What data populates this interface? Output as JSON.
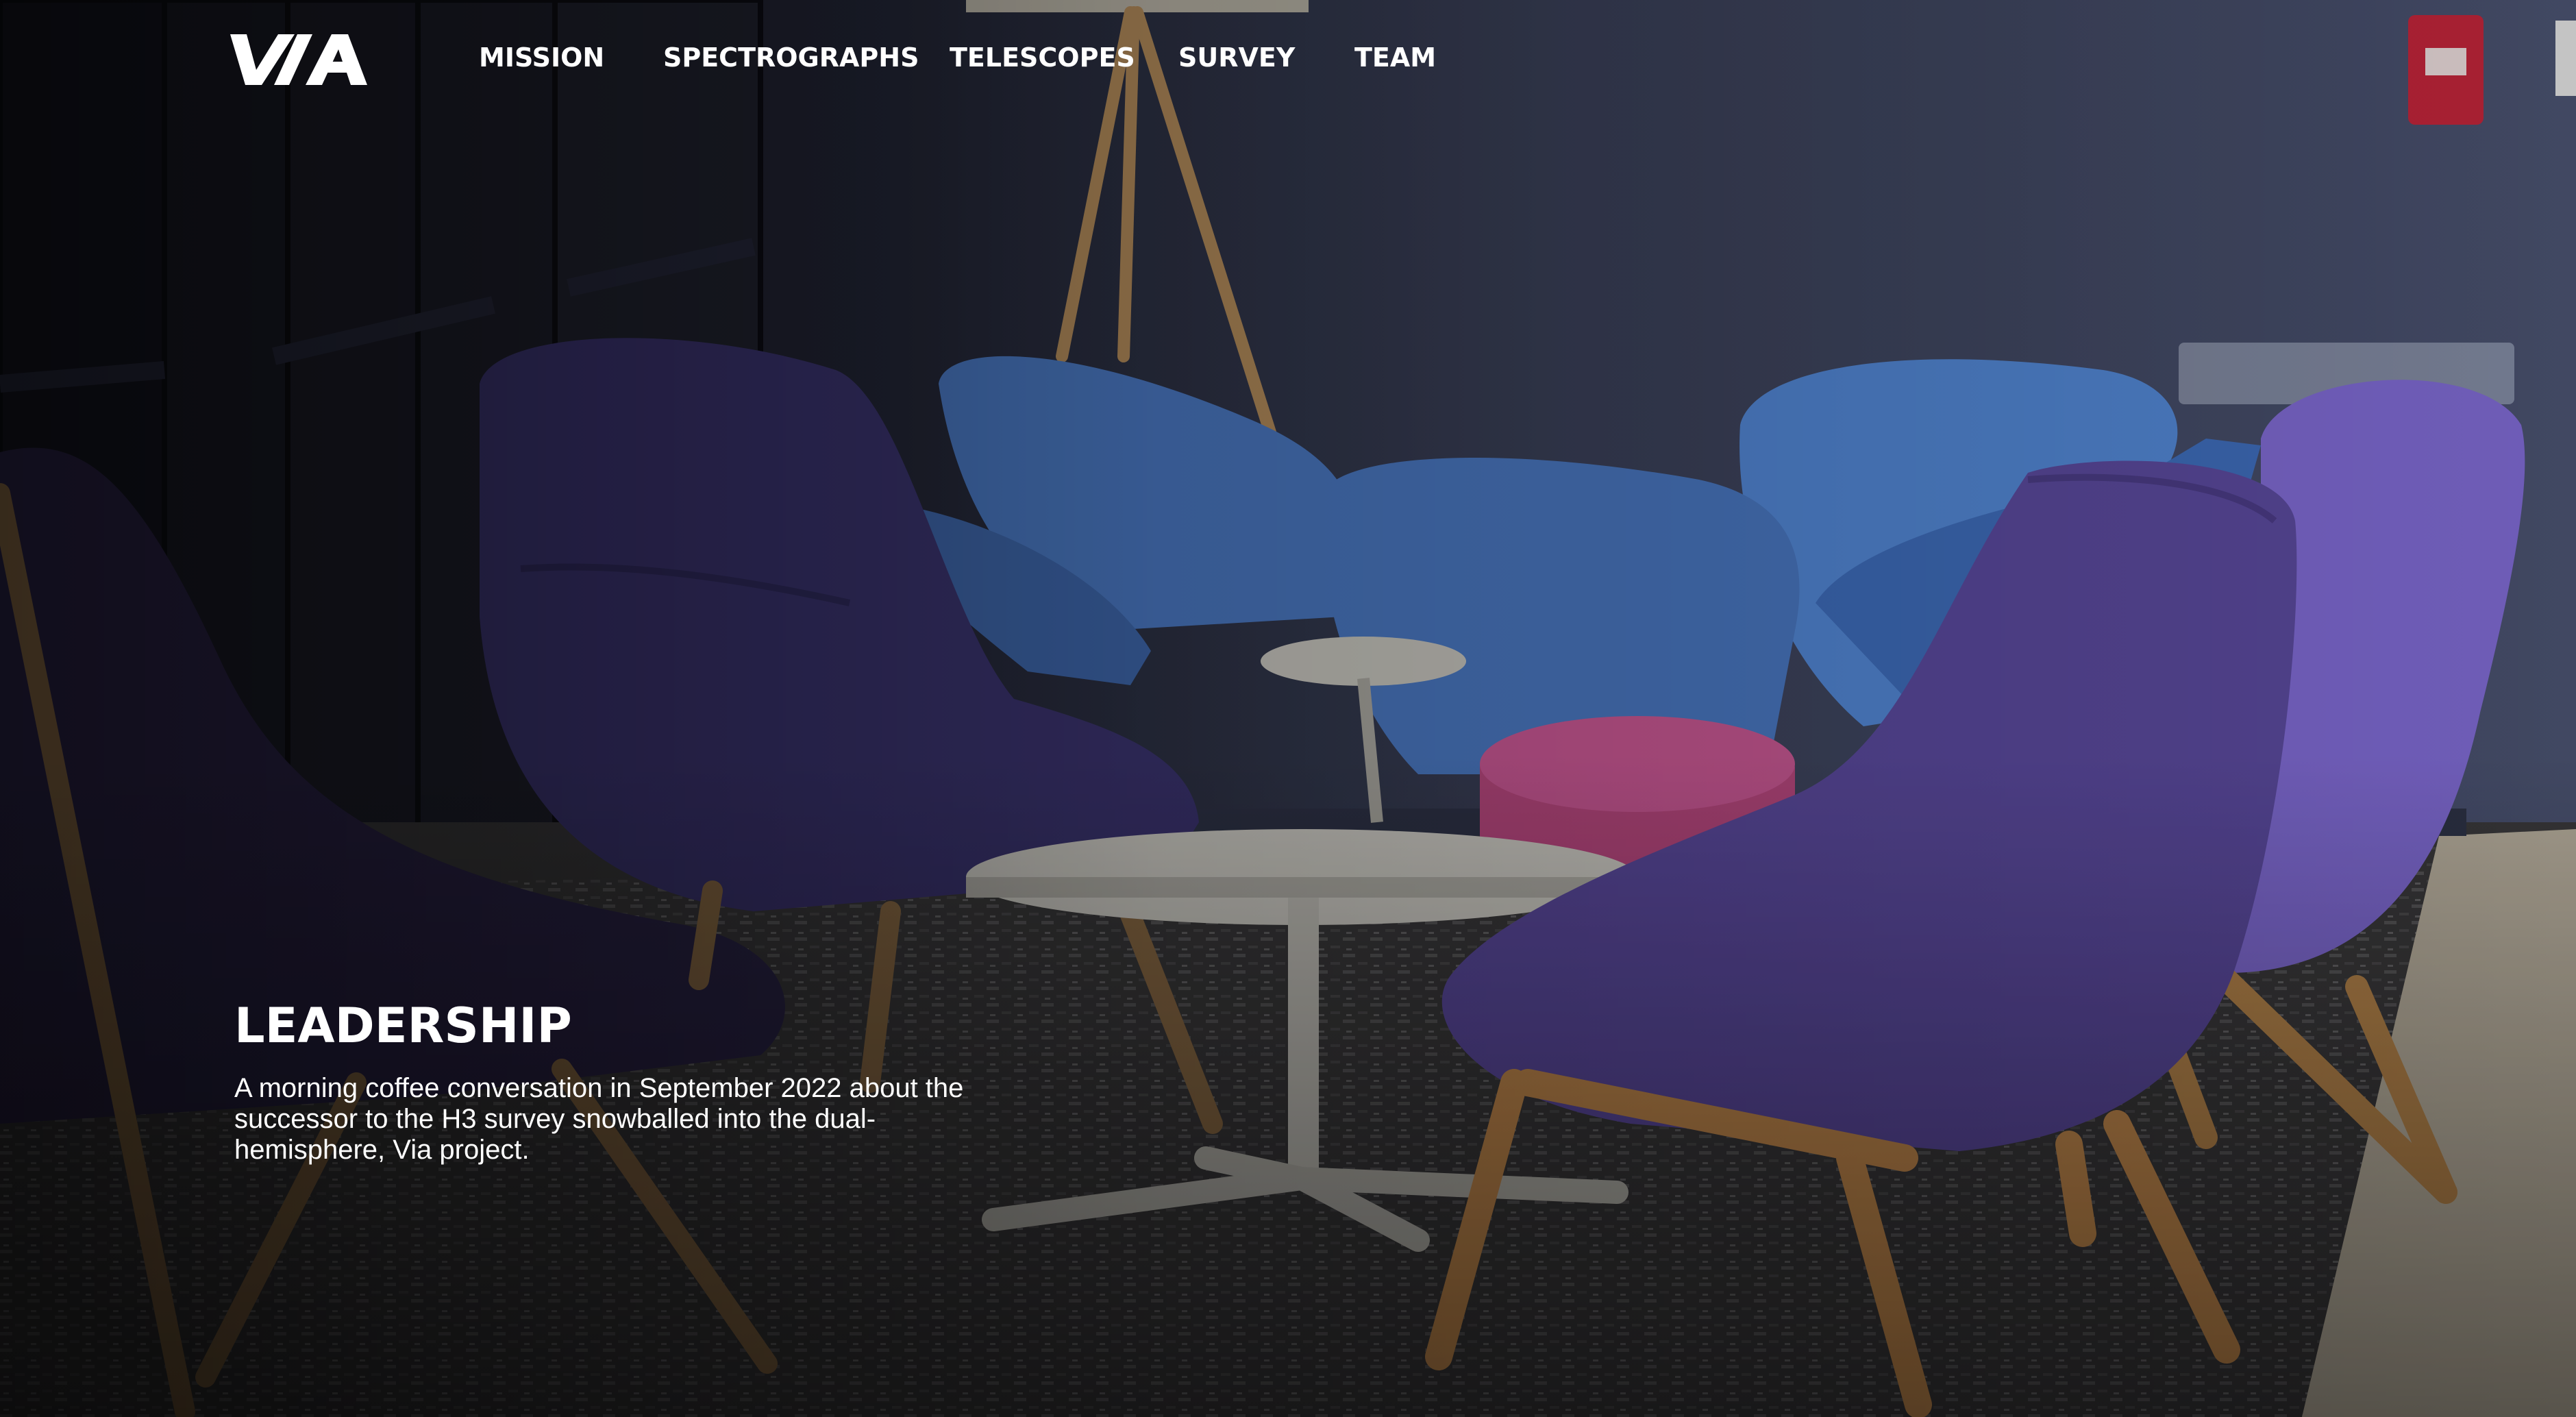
{
  "brand": {
    "logo_text": "VIA"
  },
  "nav": {
    "items": [
      {
        "label": "MISSION"
      },
      {
        "label": "SPECTROGRAPHS"
      },
      {
        "label": "TELESCOPES"
      },
      {
        "label": "SURVEY"
      },
      {
        "label": "TEAM"
      }
    ]
  },
  "hero": {
    "title": "LEADERSHIP",
    "description": "A morning coffee conversation in September 2022 about the successor to the H3 survey snowballed into the dual-hemisphere, Via project.",
    "image_subject": "lounge-with-purple-and-blue-chairs"
  },
  "colors": {
    "text": "#ffffff",
    "wall": "#3e4560",
    "chair_purple": "#5b4a9e",
    "chair_blue": "#4f7fc8",
    "ottoman_pink": "#b8487f"
  }
}
